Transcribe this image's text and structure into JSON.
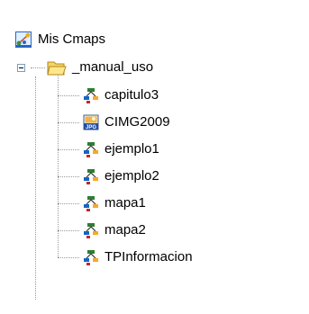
{
  "root": {
    "label": "Mis Cmaps",
    "icon": "cmap-root-icon"
  },
  "folder": {
    "label": "_manual_uso",
    "icon": "folder-open-icon",
    "expanded": true
  },
  "items": [
    {
      "label": "capitulo3",
      "icon": "cmap-icon"
    },
    {
      "label": "CIMG2009",
      "icon": "jpg-image-icon"
    },
    {
      "label": "ejemplo1",
      "icon": "cmap-icon"
    },
    {
      "label": "ejemplo2",
      "icon": "cmap-icon"
    },
    {
      "label": "mapa1",
      "icon": "cmap-icon"
    },
    {
      "label": "mapa2",
      "icon": "cmap-icon"
    },
    {
      "label": "TPInformacion",
      "icon": "cmap-icon"
    }
  ]
}
